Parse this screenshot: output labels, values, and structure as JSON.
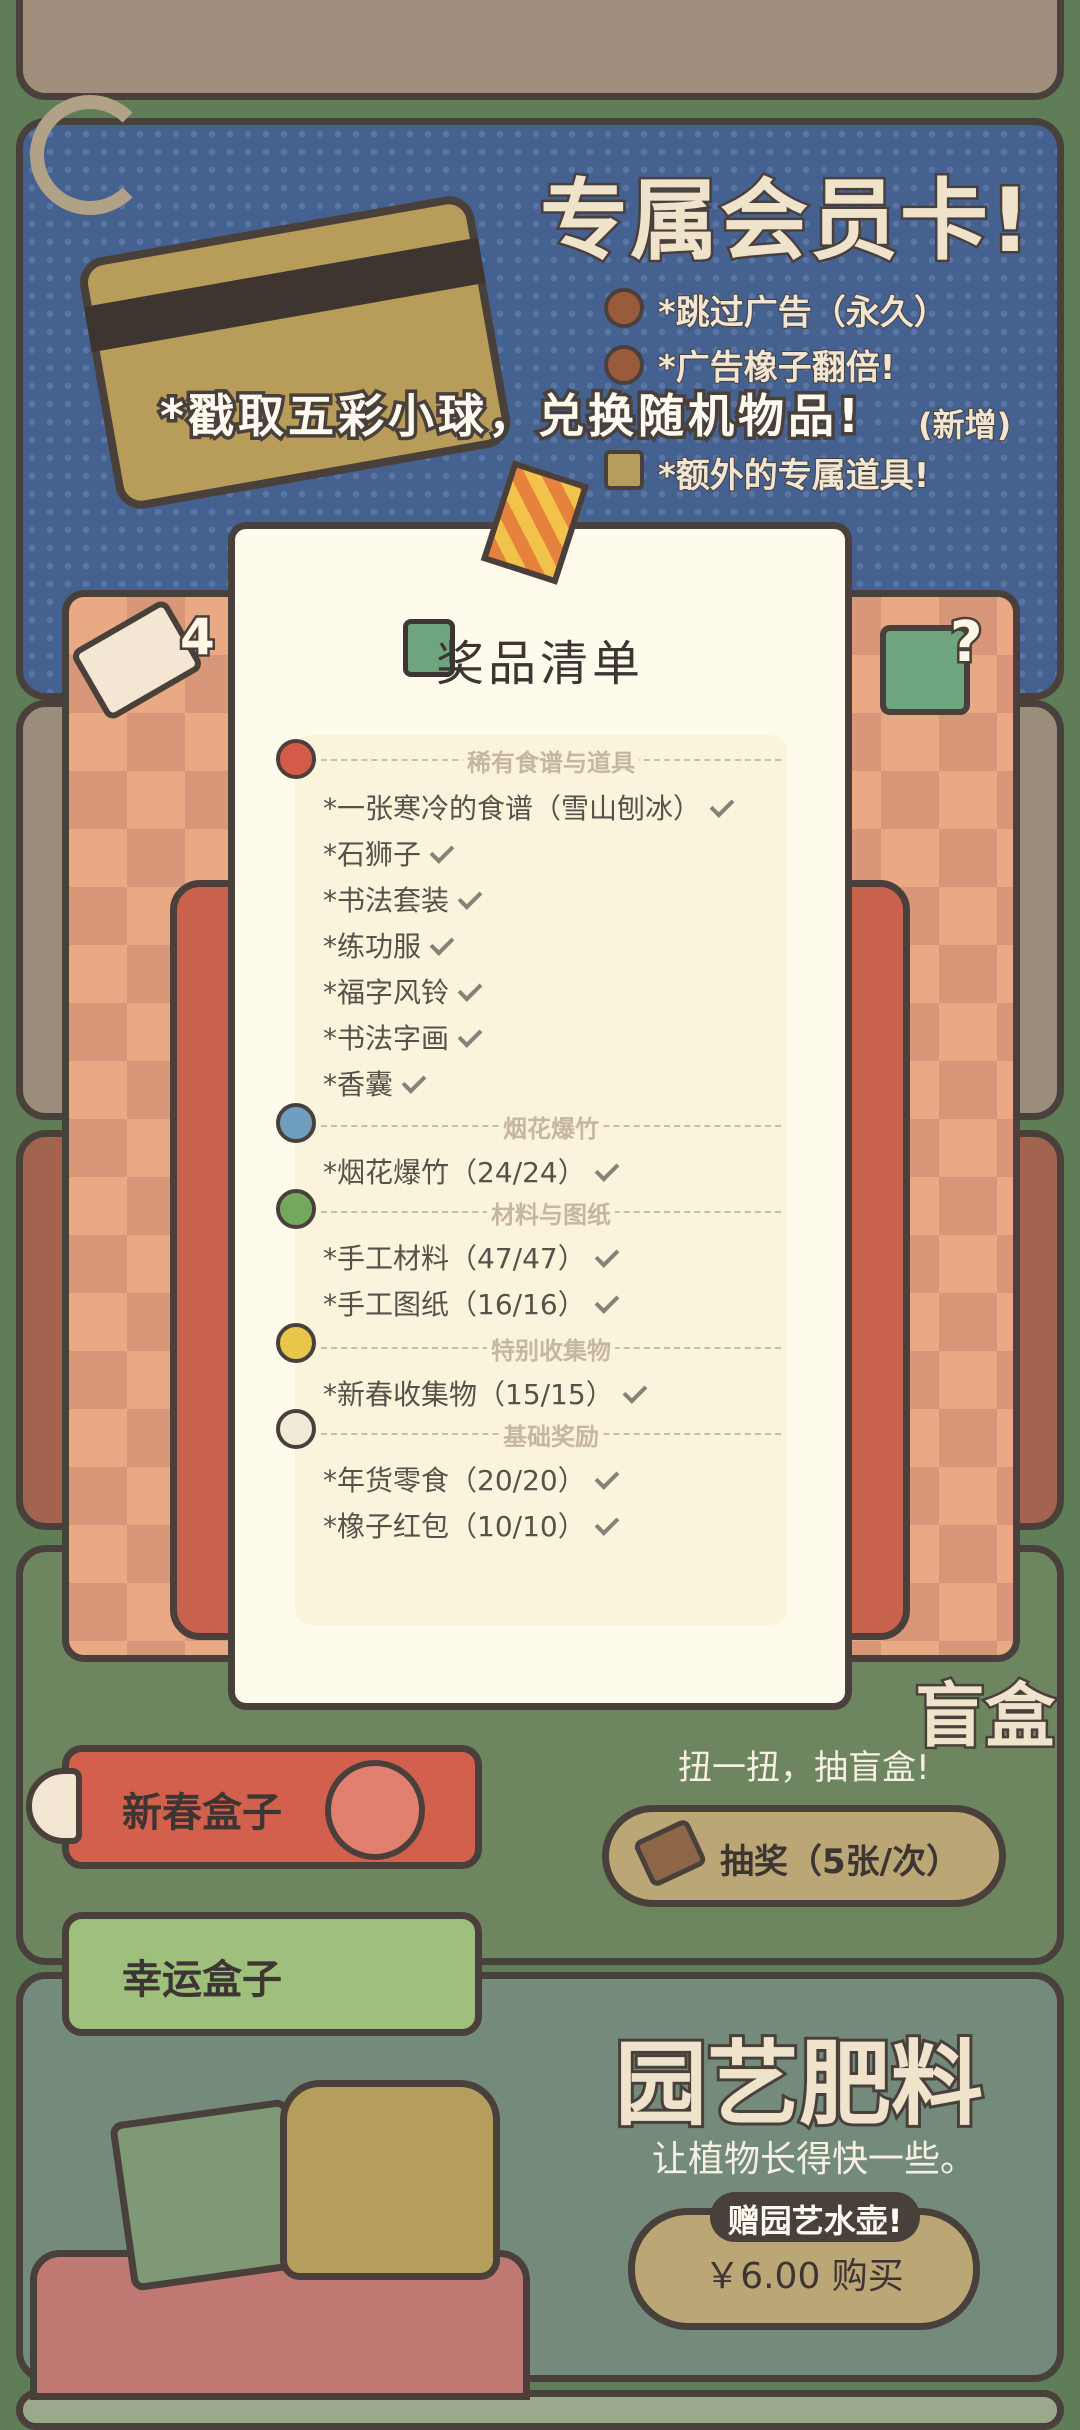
{
  "member_card": {
    "title": "专属会员卡!",
    "perks": [
      "*跳过广告（永久）",
      "*广告橡子翻倍!",
      "*额外的专属道具!"
    ],
    "perk_new": "(新增)"
  },
  "banner": "*戳取五彩小球，兑换随机物品!",
  "tickets": {
    "count": "4"
  },
  "gift_mystery_mark": "?",
  "prize_list": {
    "title": "奖品清单",
    "sections": [
      {
        "name": "稀有食谱与道具",
        "ball_color": "#d65a4a",
        "items": [
          "*一张寒冷的食谱（雪山刨冰）",
          "*石狮子",
          "*书法套装",
          "*练功服",
          "*福字风铃",
          "*书法字画",
          "*香囊"
        ]
      },
      {
        "name": "烟花爆竹",
        "ball_color": "#6f9ec0",
        "items": [
          "*烟花爆竹（24/24）"
        ]
      },
      {
        "name": "材料与图纸",
        "ball_color": "#74a85c",
        "items": [
          "*手工材料（47/47）",
          "*手工图纸（16/16）"
        ]
      },
      {
        "name": "特别收集物",
        "ball_color": "#e7c64a",
        "items": [
          "*新春收集物（15/15）"
        ]
      },
      {
        "name": "基础奖励",
        "ball_color": "#f2ead8",
        "items": [
          "*年货零食（20/20）",
          "*橡子红包（10/10）"
        ]
      }
    ]
  },
  "boxes": {
    "spring": "新春盒子",
    "lucky": "幸运盒子"
  },
  "blind_box": {
    "title": "盲盒",
    "subtitle": "扭一扭，抽盲盒!",
    "draw_button": "抽奖（5张/次）"
  },
  "garden": {
    "title": "园艺肥料",
    "subtitle": "让植物长得快一些。",
    "gift_tag": "赠园艺水壶!",
    "buy_button": "￥6.00 购买"
  }
}
